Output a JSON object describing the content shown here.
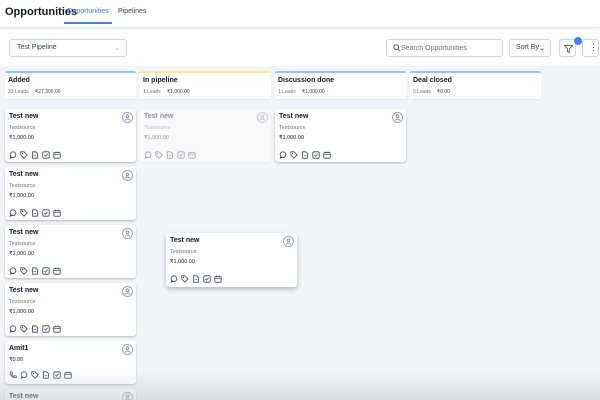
{
  "header": {
    "title": "Opportunities",
    "tabs": [
      {
        "label": "Opportunities",
        "active": true
      },
      {
        "label": "Pipelines",
        "active": false
      }
    ]
  },
  "toolbar": {
    "pipeline_select": "Test Pipeline",
    "search_placeholder": "Search Opportunities",
    "sort_label": "Sort By",
    "filter_badge_color": "#3b82f6"
  },
  "columns": [
    {
      "name": "Added",
      "leads": "33 Leads",
      "amount": "₹27,300.00"
    },
    {
      "name": "In pipeline",
      "leads": "1 Leads",
      "amount": "₹1,000.00"
    },
    {
      "name": "Discussion done",
      "leads": "1 Leads",
      "amount": "₹1,000.00"
    },
    {
      "name": "Deal closed",
      "leads": "0 Leads",
      "amount": "₹0.00"
    }
  ],
  "cards": [
    {
      "title": "Test new",
      "source": "Testsource",
      "amount": "₹1,000.00"
    },
    {
      "title": "Test new",
      "source": "Testsource",
      "amount": "₹1,000.00"
    },
    {
      "title": "Test new",
      "source": "Testsource",
      "amount": "₹1,000.00"
    },
    {
      "title": "Test new",
      "source": "Testsource",
      "amount": "₹1,000.00"
    },
    {
      "title": "Amit1",
      "source": "",
      "amount": "₹0.00"
    },
    {
      "title": "Test new",
      "source": "",
      "amount": ""
    },
    {
      "title": "Test new",
      "source": "Testsource",
      "amount": "₹1,000.00"
    },
    {
      "title": "Test new",
      "source": "Testsource",
      "amount": "₹1,000.00"
    },
    {
      "title": "Test new",
      "source": "Testsource",
      "amount": "₹1,000.00"
    }
  ],
  "card_icons": [
    "chat-icon",
    "tag-icon",
    "document-icon",
    "checkbox-icon",
    "calendar-icon"
  ],
  "card_icons_with_phone": [
    "phone-icon",
    "chat-icon",
    "tag-icon",
    "document-icon",
    "checkbox-icon",
    "calendar-icon"
  ],
  "colors": {
    "accent": "#3b82f6",
    "header_stripe": "#93c5fd",
    "in_pipeline_stripe": "#fde68a",
    "background": "#f1f5f8"
  }
}
